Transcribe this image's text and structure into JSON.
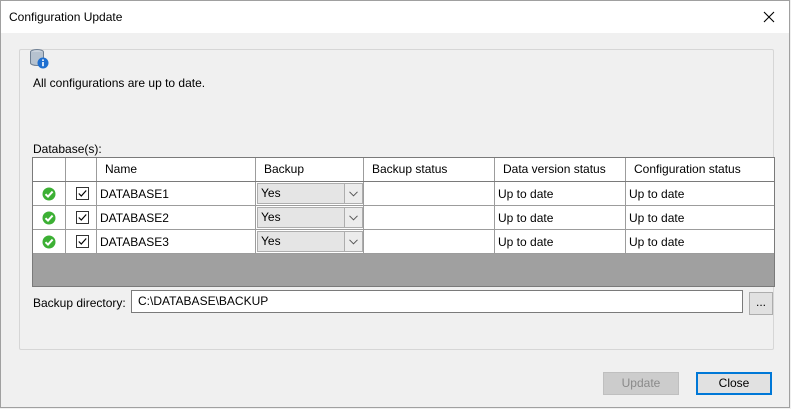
{
  "window": {
    "title": "Configuration Update"
  },
  "message": "All configurations are up to date.",
  "databases_label": "Database(s):",
  "grid": {
    "headers": [
      "",
      "",
      "Name",
      "Backup",
      "Backup status",
      "Data version status",
      "Configuration status"
    ],
    "rows": [
      {
        "status_icon": "ok-check-icon",
        "checked": true,
        "name": "DATABASE1",
        "backup": "Yes",
        "backup_status": "",
        "data_version_status": "Up to date",
        "configuration_status": "Up to date"
      },
      {
        "status_icon": "ok-check-icon",
        "checked": true,
        "name": "DATABASE2",
        "backup": "Yes",
        "backup_status": "",
        "data_version_status": "Up to date",
        "configuration_status": "Up to date"
      },
      {
        "status_icon": "ok-check-icon",
        "checked": true,
        "name": "DATABASE3",
        "backup": "Yes",
        "backup_status": "",
        "data_version_status": "Up to date",
        "configuration_status": "Up to date"
      }
    ]
  },
  "backup_directory": {
    "label": "Backup directory:",
    "value": "C:\\DATABASE\\BACKUP",
    "browse_label": "..."
  },
  "buttons": {
    "update": "Update",
    "close": "Close"
  },
  "colors": {
    "ok_green": "#3cb034",
    "focus_blue": "#0078d7",
    "empty_grid": "#a0a0a0"
  }
}
